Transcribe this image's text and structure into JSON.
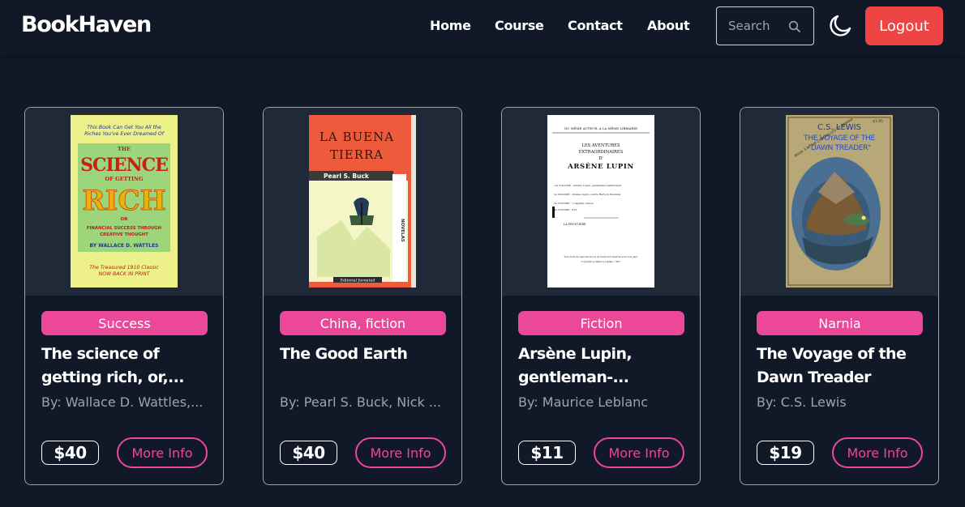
{
  "brand": {
    "name": "BookHaven"
  },
  "nav": {
    "links": [
      "Home",
      "Course",
      "Contact",
      "About"
    ],
    "search_placeholder": "Search",
    "logout_label": "Logout"
  },
  "colors": {
    "background": "#111827",
    "accent_pink": "#ec4899",
    "logout_red": "#ef4444",
    "author_gray": "#9ca3af"
  },
  "books": [
    {
      "category": "Success",
      "title": "The science of getting rich, or,...",
      "author": "By: Wallace D. Wattles,...",
      "price": "$40",
      "more_label": "More Info",
      "cover": {
        "line1": "This Book Can Get You All the",
        "line2": "Riches You've Ever Dreamed Of",
        "the": "THE",
        "science": "SCIENCE",
        "of_getting": "OF GETTING",
        "rich": "RICH",
        "or": "OR",
        "subtitle1": "FINANCIAL SUCCESS THROUGH",
        "subtitle2": "CREATIVE THOUGHT",
        "byline": "BY WALLACE D. WATTLES",
        "footer1": "The Treasured 1910 Classic",
        "footer2": "NOW BACK IN PRINT"
      }
    },
    {
      "category": "China, fiction",
      "title": "The Good Earth",
      "author": "By: Pearl S. Buck, Nick ...",
      "price": "$40",
      "more_label": "More Info",
      "cover": {
        "title1": "LA BUENA",
        "title2": "TIERRA",
        "author": "Pearl S. Buck",
        "series": "NOVELAS",
        "publisher": "Editorial Juventud"
      }
    },
    {
      "category": "Fiction",
      "title": "Arsène Lupin, gentleman-...",
      "author": "By: Maurice Leblanc",
      "price": "$11",
      "more_label": "More Info",
      "cover": {
        "header": "DU MÊME AUTEUR, A LA MÊME LIBRAIRIE",
        "line1": "LES AVENTURES",
        "line2": "EXTRAORDINAIRES",
        "line3": "D'",
        "line4": "ARSÈNE LUPIN",
        "list1": "1er VOLUME : Arsène Lupin, gentleman-cambrioleur",
        "list2": "2e VOLUME : Arsène Lupin contre Herlock Sholmès",
        "list3": "3e VOLUME : L'Aiguille creuse",
        "list4": "4e VOLUME : 813",
        "frontiere": "LA FRONTIÈRE",
        "rights": "Tous droits de reproduction et de traduction réservés pour tous pays.",
        "copyright": "Copyright by Maurice Leblanc, 1907."
      }
    },
    {
      "category": "Narnia",
      "title": "The Voyage of the Dawn Treader",
      "author": "By: C.S. Lewis",
      "price": "$19",
      "more_label": "More Info",
      "cover": {
        "price_tag": "$1.95",
        "author": "C.S. LEWIS",
        "title1": "THE VOYAGE OF THE",
        "title2": "\"DAWN TREADER\"",
        "series": "BOOK 3 IN THE CHRONICLES OF NARNIA"
      }
    }
  ]
}
